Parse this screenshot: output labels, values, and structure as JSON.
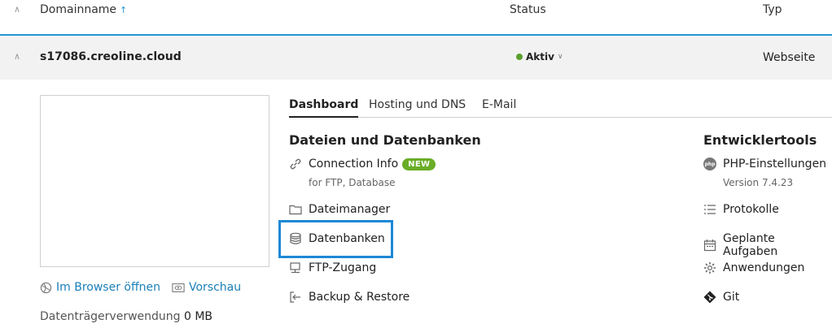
{
  "header": {
    "col_domain": "Domainname",
    "col_domain_sort": "↑",
    "col_status": "Status",
    "col_type": "Typ"
  },
  "row": {
    "domain": "s17086.creoline.cloud",
    "status": "Aktiv",
    "type": "Webseite",
    "status_color": "#5aa02c"
  },
  "preview": {
    "open_browser": "Im Browser öffnen",
    "preview": "Vorschau",
    "usage_label": "Datenträgerverwendung",
    "usage_value": "0 MB"
  },
  "tabs": [
    "Dashboard",
    "Hosting und DNS",
    "E-Mail"
  ],
  "files": {
    "title": "Dateien und Datenbanken",
    "connection_info": "Connection Info",
    "connection_badge": "NEW",
    "connection_sub": "for FTP, Database",
    "file_manager": "Dateimanager",
    "databases": "Datenbanken",
    "ftp": "FTP-Zugang",
    "backup": "Backup & Restore"
  },
  "dev": {
    "title": "Entwicklertools",
    "php": "PHP-Einstellungen",
    "php_icon_text": "php",
    "php_version": "Version 7.4.23",
    "logs": "Protokolle",
    "scheduled": "Geplante Aufgaben",
    "apps": "Anwendungen",
    "git": "Git"
  },
  "colors": {
    "accent": "#2596d1",
    "link": "#1b7fb8",
    "badge": "#6aad27",
    "highlight": "#1e88d6"
  }
}
